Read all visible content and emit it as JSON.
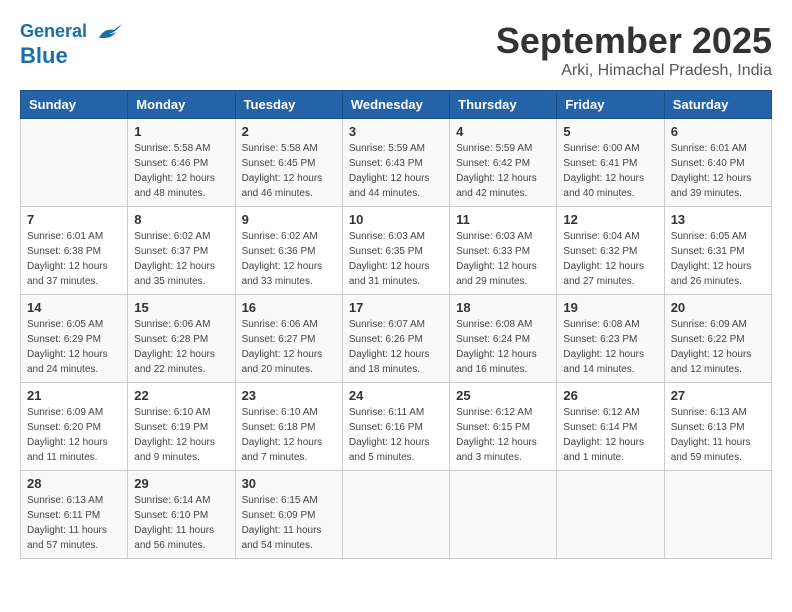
{
  "header": {
    "logo_text_general": "General",
    "logo_text_blue": "Blue",
    "month": "September 2025",
    "location": "Arki, Himachal Pradesh, India"
  },
  "weekdays": [
    "Sunday",
    "Monday",
    "Tuesday",
    "Wednesday",
    "Thursday",
    "Friday",
    "Saturday"
  ],
  "weeks": [
    [
      {
        "day": "",
        "detail": ""
      },
      {
        "day": "1",
        "detail": "Sunrise: 5:58 AM\nSunset: 6:46 PM\nDaylight: 12 hours\nand 48 minutes."
      },
      {
        "day": "2",
        "detail": "Sunrise: 5:58 AM\nSunset: 6:45 PM\nDaylight: 12 hours\nand 46 minutes."
      },
      {
        "day": "3",
        "detail": "Sunrise: 5:59 AM\nSunset: 6:43 PM\nDaylight: 12 hours\nand 44 minutes."
      },
      {
        "day": "4",
        "detail": "Sunrise: 5:59 AM\nSunset: 6:42 PM\nDaylight: 12 hours\nand 42 minutes."
      },
      {
        "day": "5",
        "detail": "Sunrise: 6:00 AM\nSunset: 6:41 PM\nDaylight: 12 hours\nand 40 minutes."
      },
      {
        "day": "6",
        "detail": "Sunrise: 6:01 AM\nSunset: 6:40 PM\nDaylight: 12 hours\nand 39 minutes."
      }
    ],
    [
      {
        "day": "7",
        "detail": "Sunrise: 6:01 AM\nSunset: 6:38 PM\nDaylight: 12 hours\nand 37 minutes."
      },
      {
        "day": "8",
        "detail": "Sunrise: 6:02 AM\nSunset: 6:37 PM\nDaylight: 12 hours\nand 35 minutes."
      },
      {
        "day": "9",
        "detail": "Sunrise: 6:02 AM\nSunset: 6:36 PM\nDaylight: 12 hours\nand 33 minutes."
      },
      {
        "day": "10",
        "detail": "Sunrise: 6:03 AM\nSunset: 6:35 PM\nDaylight: 12 hours\nand 31 minutes."
      },
      {
        "day": "11",
        "detail": "Sunrise: 6:03 AM\nSunset: 6:33 PM\nDaylight: 12 hours\nand 29 minutes."
      },
      {
        "day": "12",
        "detail": "Sunrise: 6:04 AM\nSunset: 6:32 PM\nDaylight: 12 hours\nand 27 minutes."
      },
      {
        "day": "13",
        "detail": "Sunrise: 6:05 AM\nSunset: 6:31 PM\nDaylight: 12 hours\nand 26 minutes."
      }
    ],
    [
      {
        "day": "14",
        "detail": "Sunrise: 6:05 AM\nSunset: 6:29 PM\nDaylight: 12 hours\nand 24 minutes."
      },
      {
        "day": "15",
        "detail": "Sunrise: 6:06 AM\nSunset: 6:28 PM\nDaylight: 12 hours\nand 22 minutes."
      },
      {
        "day": "16",
        "detail": "Sunrise: 6:06 AM\nSunset: 6:27 PM\nDaylight: 12 hours\nand 20 minutes."
      },
      {
        "day": "17",
        "detail": "Sunrise: 6:07 AM\nSunset: 6:26 PM\nDaylight: 12 hours\nand 18 minutes."
      },
      {
        "day": "18",
        "detail": "Sunrise: 6:08 AM\nSunset: 6:24 PM\nDaylight: 12 hours\nand 16 minutes."
      },
      {
        "day": "19",
        "detail": "Sunrise: 6:08 AM\nSunset: 6:23 PM\nDaylight: 12 hours\nand 14 minutes."
      },
      {
        "day": "20",
        "detail": "Sunrise: 6:09 AM\nSunset: 6:22 PM\nDaylight: 12 hours\nand 12 minutes."
      }
    ],
    [
      {
        "day": "21",
        "detail": "Sunrise: 6:09 AM\nSunset: 6:20 PM\nDaylight: 12 hours\nand 11 minutes."
      },
      {
        "day": "22",
        "detail": "Sunrise: 6:10 AM\nSunset: 6:19 PM\nDaylight: 12 hours\nand 9 minutes."
      },
      {
        "day": "23",
        "detail": "Sunrise: 6:10 AM\nSunset: 6:18 PM\nDaylight: 12 hours\nand 7 minutes."
      },
      {
        "day": "24",
        "detail": "Sunrise: 6:11 AM\nSunset: 6:16 PM\nDaylight: 12 hours\nand 5 minutes."
      },
      {
        "day": "25",
        "detail": "Sunrise: 6:12 AM\nSunset: 6:15 PM\nDaylight: 12 hours\nand 3 minutes."
      },
      {
        "day": "26",
        "detail": "Sunrise: 6:12 AM\nSunset: 6:14 PM\nDaylight: 12 hours\nand 1 minute."
      },
      {
        "day": "27",
        "detail": "Sunrise: 6:13 AM\nSunset: 6:13 PM\nDaylight: 11 hours\nand 59 minutes."
      }
    ],
    [
      {
        "day": "28",
        "detail": "Sunrise: 6:13 AM\nSunset: 6:11 PM\nDaylight: 11 hours\nand 57 minutes."
      },
      {
        "day": "29",
        "detail": "Sunrise: 6:14 AM\nSunset: 6:10 PM\nDaylight: 11 hours\nand 56 minutes."
      },
      {
        "day": "30",
        "detail": "Sunrise: 6:15 AM\nSunset: 6:09 PM\nDaylight: 11 hours\nand 54 minutes."
      },
      {
        "day": "",
        "detail": ""
      },
      {
        "day": "",
        "detail": ""
      },
      {
        "day": "",
        "detail": ""
      },
      {
        "day": "",
        "detail": ""
      }
    ]
  ]
}
